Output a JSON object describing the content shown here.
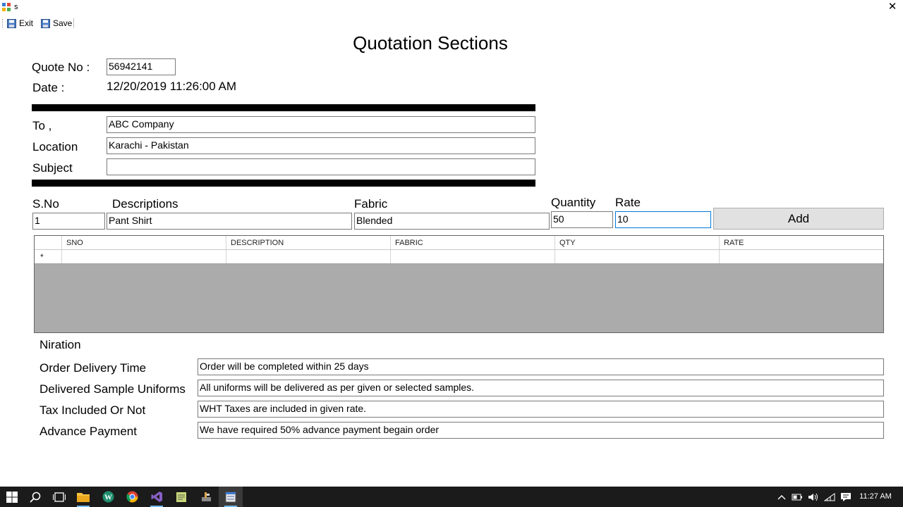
{
  "window": {
    "title": "s"
  },
  "toolbar": {
    "exit_label": "Exit",
    "save_label": "Save"
  },
  "form": {
    "title": "Quotation Sections",
    "quote_no_label": "Quote No :",
    "quote_no_value": "56942141",
    "date_label": "Date :",
    "date_value": "12/20/2019 11:26:00 AM",
    "to_label": "To ,",
    "to_value": "ABC Company",
    "location_label": "Location",
    "location_value": "Karachi - Pakistan",
    "subject_label": "Subject",
    "subject_value": ""
  },
  "entry": {
    "sno_label": "S.No",
    "sno_value": "1",
    "descriptions_label": "Descriptions",
    "descriptions_value": "Pant Shirt",
    "fabric_label": "Fabric",
    "fabric_value": "Blended",
    "quantity_label": "Quantity",
    "quantity_value": "50",
    "rate_label": "Rate",
    "rate_value": "10",
    "add_label": "Add"
  },
  "grid": {
    "columns": [
      "SNO",
      "DESCRIPTION",
      "FABRIC",
      "QTY",
      "RATE"
    ],
    "new_row_marker": "*"
  },
  "niration": {
    "heading": "Niration",
    "delivery_label": "Order Delivery Time",
    "delivery_value": "Order will be completed within 25 days",
    "samples_label": "Delivered Sample Uniforms",
    "samples_value": "All uniforms will be delivered as per given or selected samples.",
    "tax_label": "Tax Included Or Not",
    "tax_value": "WHT Taxes are included in given rate.",
    "advance_label": "Advance Payment",
    "advance_value": "We have required 50% advance payment begain order"
  },
  "taskbar": {
    "time": "11:27 AM"
  },
  "colors": {
    "focus_border": "#0078d7",
    "grid_bg": "#ababab",
    "taskbar_bg": "#1b1b1b",
    "button_bg": "#e1e1e1"
  }
}
